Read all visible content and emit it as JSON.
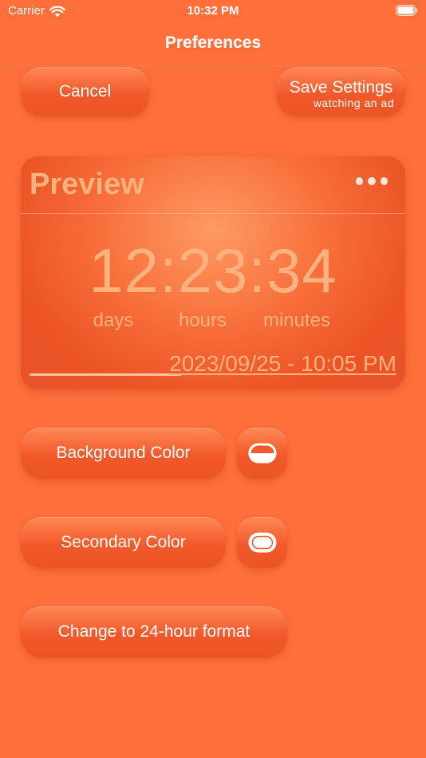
{
  "status_bar": {
    "carrier": "Carrier",
    "time": "10:32 PM"
  },
  "nav": {
    "title": "Preferences"
  },
  "actions": {
    "cancel_label": "Cancel",
    "save_label": "Save Settings",
    "save_sublabel": "watching an ad"
  },
  "preview": {
    "title": "Preview",
    "countdown": "12:23:34",
    "units": {
      "days": "days",
      "hours": "hours",
      "minutes": "minutes"
    },
    "target_date": "2023/09/25 - 10:05 PM"
  },
  "settings": {
    "background_color_label": "Background Color",
    "secondary_color_label": "Secondary Color",
    "format_toggle_label": "Change to 24-hour format"
  },
  "colors": {
    "page_background": "#FF6F3C",
    "button_fill": "#F2592A",
    "preview_text": "#FFB27E",
    "secondary_swatch": "#FFFFFF"
  },
  "icons": {
    "carrier_signal": "wifi-icon",
    "battery": "battery-icon",
    "menu": "more-icon",
    "background_swatch": "half-filled-swatch-icon",
    "secondary_swatch": "outlined-swatch-icon"
  }
}
